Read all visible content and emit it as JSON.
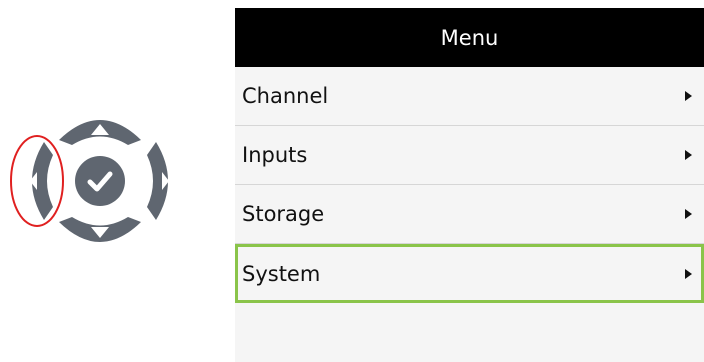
{
  "menu": {
    "title": "Menu",
    "items": [
      {
        "label": "Channel",
        "selected": false
      },
      {
        "label": "Inputs",
        "selected": false
      },
      {
        "label": "Storage",
        "selected": false
      },
      {
        "label": "System",
        "selected": true
      }
    ]
  },
  "dpad": {
    "highlighted_button": "left",
    "highlight_color": "#e02020",
    "button_color": "#5f6670"
  },
  "colors": {
    "selection_border": "#8ac44a",
    "header_bg": "#000000",
    "menu_bg": "#f5f5f5"
  }
}
